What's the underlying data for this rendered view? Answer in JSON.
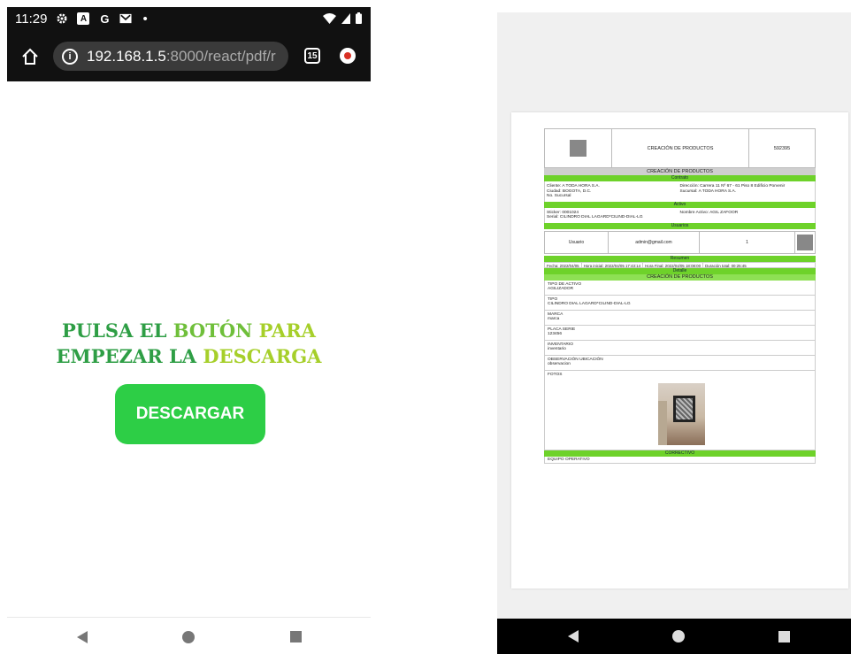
{
  "left_phone": {
    "status_bar": {
      "time": "11:29",
      "icons": [
        "gear-icon",
        "a-icon",
        "google-g-icon",
        "gmail-icon"
      ],
      "letters": {
        "a": "A",
        "g": "G"
      },
      "dot": "•",
      "right_icons": [
        "wifi-icon",
        "signal-icon",
        "battery-icon"
      ]
    },
    "browser": {
      "url_host": "192.168.1.5",
      "url_path": ":8000/react/pdf/r",
      "tab_count": "15"
    },
    "headline": {
      "line1_word1": "PULSA EL ",
      "line1_word2": "BOTÓN ",
      "line1_word3": "PARA",
      "line2_word1": "EMPEZAR LA ",
      "line2_word2": "DESCARGA"
    },
    "download_button": "DESCARGAR",
    "colors": {
      "accent_green": "#2dce46",
      "headline_green_dark": "#2e9e45",
      "headline_green_mid": "#6fbf3a",
      "headline_green_light": "#a6cf2a"
    }
  },
  "right_viewer": {
    "pdf": {
      "header_title": "CREACIÓN DE PRODUCTOS",
      "header_number": "592395",
      "section_title": "CREACIÓN DE PRODUCTOS",
      "contract_bar": "Contrato",
      "contract_left": [
        "Cliente: A TODA HORA S.A.",
        "Ciudad: BOGOTA, D.C.",
        "No. Sucursal"
      ],
      "contract_right": [
        "Dirección: Carrera 11 Nº 67 - 61 Piso 8 Edificio Porvenir",
        "Sucursal: A TODA HORA S.A."
      ],
      "active_bar": "Activo",
      "active_left": [
        "Sticker: 0001024",
        "Serial: CILINDRO DIAL LAGARD*CILIND-DIAL-LG"
      ],
      "active_right": [
        "Nombre Activo: AGIL ZAFOOR"
      ],
      "users_bar": "Usuarios",
      "users_row": {
        "role": "Usuario",
        "email": "admin@gmail.com",
        "id": "1"
      },
      "summary_bar": "Resumen",
      "summary": [
        "Fecha: 2022/04/05",
        "Hora inicial: 2022/04/05 17:43:14",
        "Hora Final: 2022/04/05 18:08:00",
        "Duración total: 00:25:45"
      ],
      "detail_bar": "Detalle",
      "detail_title": "CREACIÓN DE PRODUCTOS",
      "fields": [
        {
          "label": "TIPO DE ACTIVO",
          "value": "AGILIZADOR"
        },
        {
          "label": "TIPO",
          "value": "CILINDRO DIAL LAGARD*CILIND-DIAL-LG"
        },
        {
          "label": "MARCA",
          "value": "marca"
        },
        {
          "label": "PLACA SERIE",
          "value": "123456"
        },
        {
          "label": "INVENTARIO",
          "value": "inventario"
        },
        {
          "label": "OBSERVACIÓN UBICACIÓN",
          "value": "observacion"
        }
      ],
      "photos_label": "FOTOS",
      "corrective_bar": "CORRECTIVO",
      "corrective_value": "EQUIPO OPERATIVO"
    },
    "colors": {
      "bar_green": "#6ed22a",
      "bar_light_green": "#8ee054",
      "bar_grey": "#cfcfcf"
    }
  }
}
